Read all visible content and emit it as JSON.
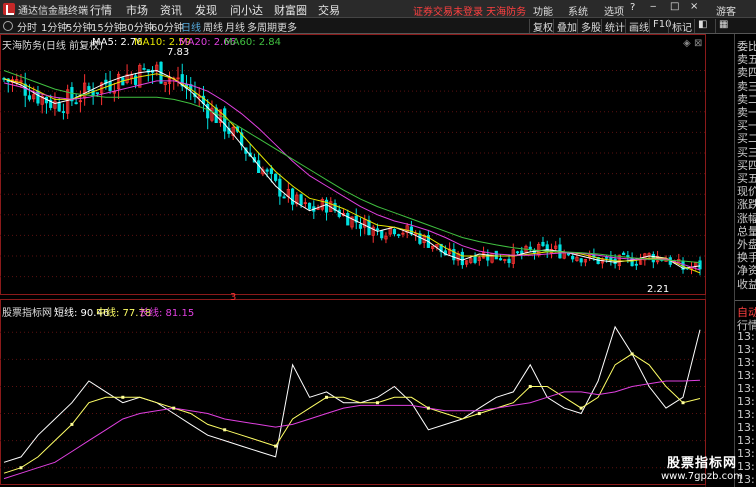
{
  "app": {
    "name": "通达信金融终端"
  },
  "top_menu": [
    "行情",
    "市场",
    "资讯",
    "发现",
    "问小达",
    "财富圈",
    "交易"
  ],
  "notice": "证券交易未登录  天海防务",
  "right_menu": [
    "功能",
    "系统",
    "选项"
  ],
  "guest": "游客",
  "periods": [
    "分时",
    "1分钟",
    "5分钟",
    "15分钟",
    "30分钟",
    "60分钟",
    "日线",
    "周线",
    "月线",
    "多周期",
    "更多"
  ],
  "active_period": "日线",
  "toolbar_buttons": [
    "复权",
    "叠加",
    "多股",
    "统计",
    "画线",
    "F10",
    "标记"
  ],
  "main_legend": {
    "title": "天海防务(日线 前复权)",
    "ma5": "MA5: 2.76",
    "ma10": "MA10: 2.59",
    "ma20": "MA20: 2.66",
    "ma60": "MA60: 2.84"
  },
  "sub_legend": {
    "title": "股票指标网",
    "short": "短线: 90.46",
    "mid": "中线: 77.78",
    "long": "长线: 81.15"
  },
  "annotations": {
    "high": "7.83",
    "low": "2.21",
    "marker": "3"
  },
  "colors": {
    "ma5": "#ffffff",
    "ma10": "#e6e600",
    "ma20": "#e040e0",
    "ma60": "#40c040",
    "up": "#ff3232",
    "down": "#00e0e0",
    "short": "#ffffff",
    "mid": "#ffff66",
    "long": "#e040e0"
  },
  "right_panel": {
    "top_items": [
      "委比",
      "卖五",
      "卖四",
      "卖三",
      "卖二",
      "卖一",
      "买一",
      "买二",
      "买三",
      "买四",
      "买五",
      "现价",
      "涨跌",
      "涨幅",
      "总量",
      "外盘",
      "换手",
      "净资",
      "收益"
    ],
    "bottom_items": [
      "自动",
      "行情",
      "13:1",
      "13:1",
      "13:1",
      "13:1",
      "13:1",
      "13:1",
      "13:1",
      "13:1",
      "13:1",
      "13:1",
      "13:1",
      "13:1"
    ]
  },
  "watermark": {
    "line1": "股票指标网",
    "line2": "www.7gpzb.com"
  },
  "chart_data": [
    {
      "type": "candlestick",
      "title": "天海防务(日线 前复权)",
      "y_ticks": [
        7.5,
        7.0,
        6.5,
        6.0,
        5.5,
        5.0,
        4.5,
        4.0,
        3.5,
        3.0,
        2.5
      ],
      "ylim": [
        2.2,
        7.95
      ],
      "high": 7.83,
      "low": 2.21,
      "series": [
        {
          "name": "MA5",
          "values": [
            7.3,
            7.15,
            6.9,
            6.7,
            6.8,
            7.0,
            7.2,
            7.35,
            7.45,
            7.5,
            7.3,
            7.0,
            6.6,
            6.2,
            5.7,
            5.2,
            4.7,
            4.35,
            4.1,
            4.25,
            4.0,
            3.8,
            3.6,
            3.7,
            3.55,
            3.35,
            3.05,
            2.9,
            3.05,
            3.0,
            3.0,
            3.1,
            3.15,
            3.1,
            3.0,
            2.9,
            2.85,
            2.9,
            3.0,
            2.95,
            2.7,
            2.76
          ]
        },
        {
          "name": "MA10",
          "values": [
            7.3,
            7.2,
            7.0,
            6.8,
            6.8,
            6.95,
            7.1,
            7.25,
            7.35,
            7.42,
            7.3,
            7.05,
            6.75,
            6.4,
            5.95,
            5.5,
            5.05,
            4.7,
            4.4,
            4.3,
            4.15,
            3.95,
            3.75,
            3.7,
            3.6,
            3.45,
            3.2,
            3.0,
            3.0,
            3.0,
            3.0,
            3.05,
            3.1,
            3.1,
            3.05,
            2.95,
            2.88,
            2.88,
            2.95,
            2.95,
            2.75,
            2.59
          ]
        },
        {
          "name": "MA20",
          "values": [
            7.2,
            7.1,
            6.95,
            6.85,
            6.8,
            6.85,
            6.95,
            7.05,
            7.15,
            7.25,
            7.25,
            7.15,
            7.0,
            6.75,
            6.45,
            6.1,
            5.7,
            5.3,
            4.95,
            4.7,
            4.45,
            4.2,
            4.0,
            3.85,
            3.75,
            3.62,
            3.45,
            3.25,
            3.12,
            3.05,
            3.02,
            3.02,
            3.05,
            3.08,
            3.07,
            3.02,
            2.96,
            2.92,
            2.92,
            2.93,
            2.8,
            2.66
          ]
        },
        {
          "name": "MA60",
          "values": [
            7.5,
            7.35,
            7.2,
            7.05,
            6.95,
            6.9,
            6.85,
            6.85,
            6.85,
            6.85,
            6.8,
            6.7,
            6.55,
            6.35,
            6.1,
            5.85,
            5.6,
            5.35,
            5.1,
            4.85,
            4.6,
            4.38,
            4.2,
            4.05,
            3.9,
            3.75,
            3.6,
            3.45,
            3.35,
            3.27,
            3.2,
            3.15,
            3.12,
            3.1,
            3.08,
            3.05,
            3.0,
            2.96,
            2.92,
            2.9,
            2.88,
            2.84
          ]
        }
      ]
    },
    {
      "type": "line",
      "title": "股票指标网",
      "y_ticks": [
        90.0,
        85.0,
        80.0,
        75.0,
        70.0,
        65.0
      ],
      "ylim": [
        62,
        93
      ],
      "series": [
        {
          "name": "短线",
          "values": [
            66,
            67,
            71,
            74,
            77,
            81,
            79,
            77,
            78,
            77,
            75,
            73,
            71,
            70,
            69,
            68,
            67,
            84,
            78,
            79,
            77,
            77,
            78,
            80,
            77,
            72,
            73,
            74,
            76,
            78,
            79,
            84,
            78,
            76,
            75,
            81,
            91,
            86,
            80,
            76,
            78,
            90.46
          ]
        },
        {
          "name": "中线",
          "values": [
            64,
            65,
            67,
            70,
            73,
            77,
            78,
            78,
            78,
            77,
            76,
            75,
            73,
            72,
            71,
            70,
            69,
            74,
            76,
            78,
            78,
            77,
            77,
            78,
            78,
            76,
            75,
            74,
            75,
            76,
            77,
            80,
            80,
            78,
            76,
            78,
            84,
            86,
            84,
            80,
            77,
            77.78
          ]
        },
        {
          "name": "长线",
          "values": [
            63,
            64,
            65,
            66,
            68,
            70,
            72,
            74,
            75,
            75.5,
            76,
            75.5,
            75,
            74,
            73.5,
            73,
            72.5,
            73,
            74,
            75,
            76,
            76.5,
            76.5,
            76.5,
            76.5,
            76,
            75.5,
            75.5,
            75.5,
            76,
            76.5,
            77,
            78,
            79,
            79,
            78.5,
            79,
            80,
            80.5,
            81,
            81,
            81.15
          ]
        }
      ]
    }
  ]
}
